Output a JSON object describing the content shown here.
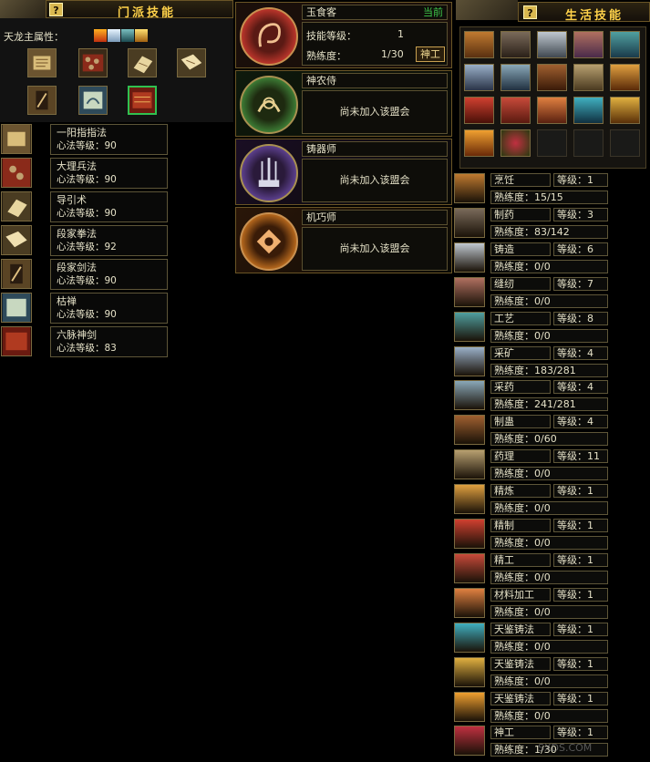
{
  "sect_panel": {
    "title": "门派技能",
    "help_label": "?",
    "attribute_label": "天龙主属性：",
    "skills": [
      {
        "name": "一阳指指法",
        "level_text": "心法等级：90"
      },
      {
        "name": "大理兵法",
        "level_text": "心法等级：90"
      },
      {
        "name": "导引术",
        "level_text": "心法等级：90"
      },
      {
        "name": "段家拳法",
        "level_text": "心法等级：92"
      },
      {
        "name": "段家剑法",
        "level_text": "心法等级：90"
      },
      {
        "name": "枯禅",
        "level_text": "心法等级：90"
      },
      {
        "name": "六脉神剑",
        "level_text": "心法等级：83"
      }
    ]
  },
  "guild_panel": {
    "guilds": [
      {
        "name": "玉食客",
        "status_badge": "当前",
        "skill_level_label": "技能等级：",
        "skill_level_value": "1",
        "proficiency_label": "熟练度：",
        "proficiency_value": "1/30",
        "button_label": "神工",
        "medal_color": "#b8342a"
      },
      {
        "name": "神农侍",
        "message": "尚未加入该盟会",
        "medal_color": "#3c7a34"
      },
      {
        "name": "铸器师",
        "message": "尚未加入该盟会",
        "medal_color": "#5b3f8c"
      },
      {
        "name": "机巧师",
        "message": "尚未加入该盟会",
        "medal_color": "#b3661c"
      }
    ]
  },
  "life_panel": {
    "title": "生活技能",
    "help_label": "?",
    "skills": [
      {
        "name": "烹饪",
        "level": "等级：1",
        "proficiency": "熟练度：15/15"
      },
      {
        "name": "制药",
        "level": "等级：3",
        "proficiency": "熟练度：83/142"
      },
      {
        "name": "铸造",
        "level": "等级：6",
        "proficiency": "熟练度：0/0"
      },
      {
        "name": "缝纫",
        "level": "等级：7",
        "proficiency": "熟练度：0/0"
      },
      {
        "name": "工艺",
        "level": "等级：8",
        "proficiency": "熟练度：0/0"
      },
      {
        "name": "采矿",
        "level": "等级：4",
        "proficiency": "熟练度：183/281"
      },
      {
        "name": "采药",
        "level": "等级：4",
        "proficiency": "熟练度：241/281"
      },
      {
        "name": "制蛊",
        "level": "等级：4",
        "proficiency": "熟练度：0/60"
      },
      {
        "name": "药理",
        "level": "等级：11",
        "proficiency": "熟练度：0/0"
      },
      {
        "name": "精炼",
        "level": "等级：1",
        "proficiency": "熟练度：0/0"
      },
      {
        "name": "精制",
        "level": "等级：1",
        "proficiency": "熟练度：0/0"
      },
      {
        "name": "精工",
        "level": "等级：1",
        "proficiency": "熟练度：0/0"
      },
      {
        "name": "材料加工",
        "level": "等级：1",
        "proficiency": "熟练度：0/0"
      },
      {
        "name": "天鉴铸法",
        "level": "等级：1",
        "proficiency": "熟练度：0/0"
      },
      {
        "name": "天鉴铸法",
        "level": "等级：1",
        "proficiency": "熟练度：0/0"
      },
      {
        "name": "天鉴铸法",
        "level": "等级：1",
        "proficiency": "熟练度：0/0"
      },
      {
        "name": "神工",
        "level": "等级：1",
        "proficiency": "熟练度：1/30"
      }
    ]
  },
  "watermark": "SXDS.COM",
  "colors": {
    "gold_title": "#ffd24a",
    "text": "#e6e2c8",
    "badge_green": "#3ec84a",
    "frame": "#6a5526"
  }
}
